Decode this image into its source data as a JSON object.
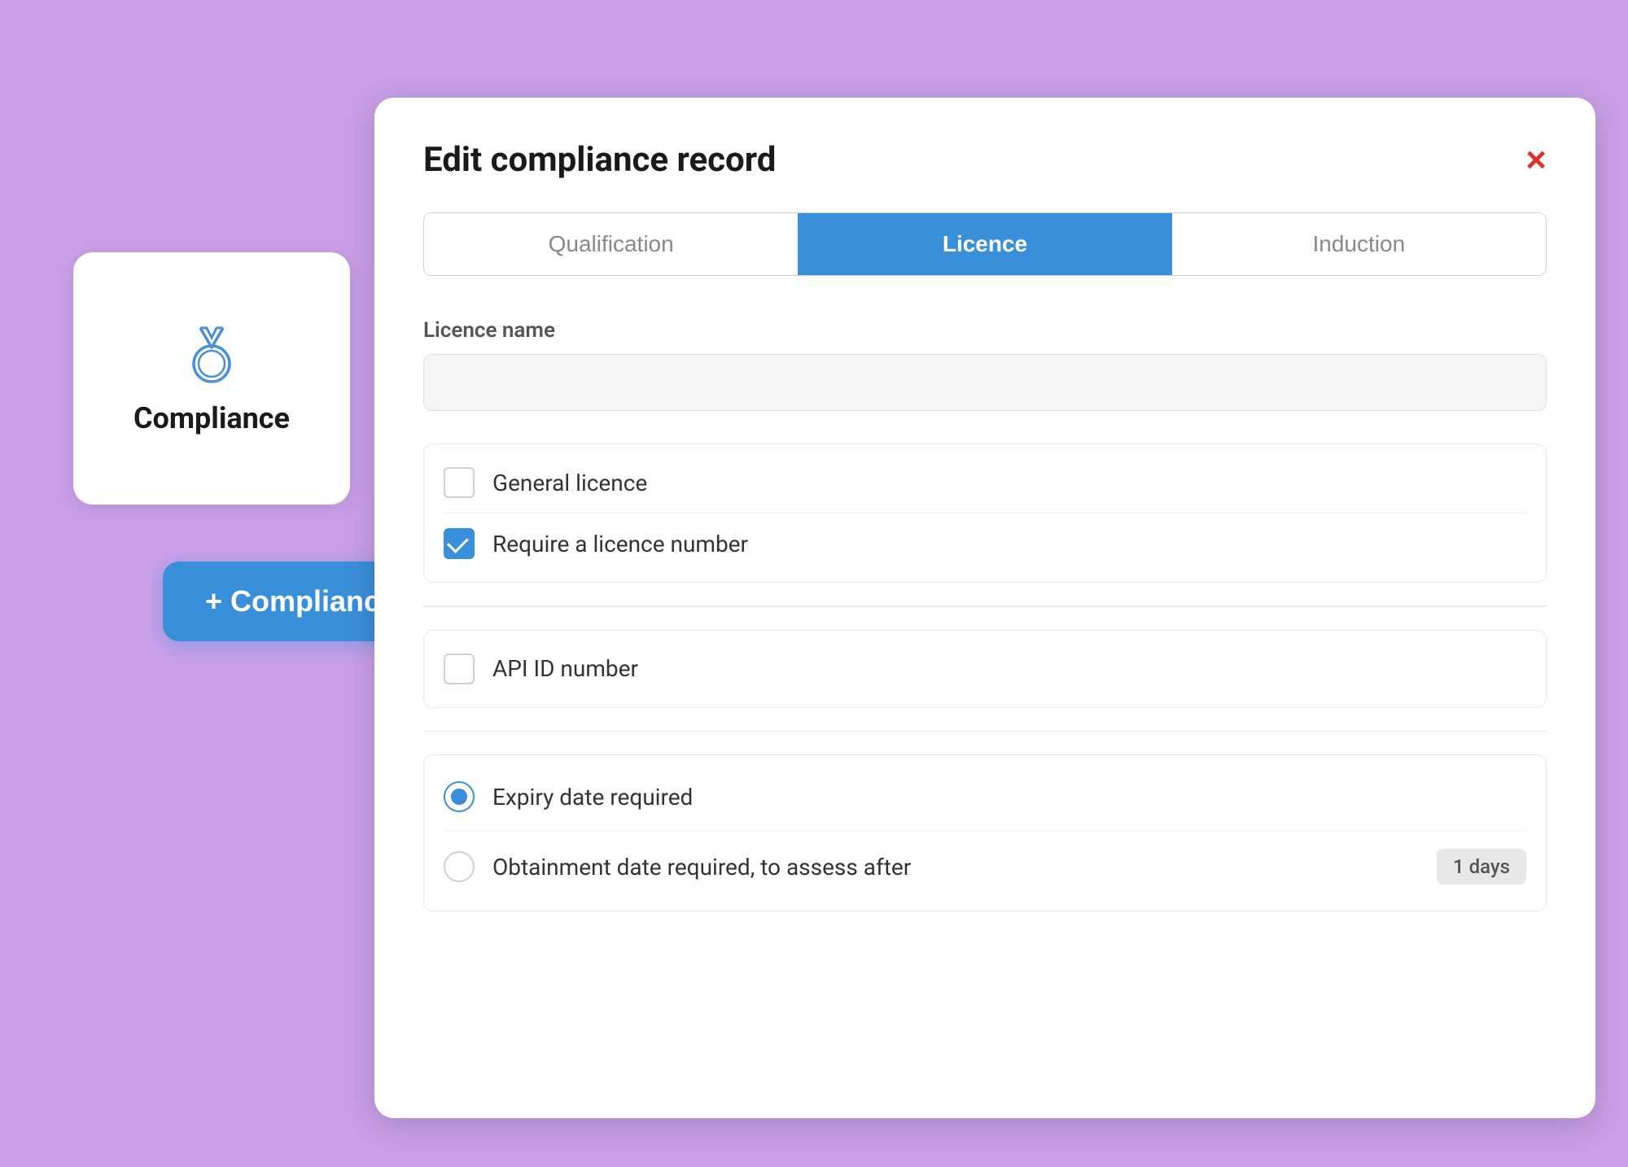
{
  "background": {
    "color": "#c9a0e8"
  },
  "compliance_card": {
    "label": "Compliance",
    "icon_alt": "compliance-medal-icon"
  },
  "add_record_button": {
    "label": "+ Compliance record"
  },
  "modal": {
    "title": "Edit compliance record",
    "close_label": "×",
    "tabs": [
      {
        "label": "Qualification",
        "active": false
      },
      {
        "label": "Licence",
        "active": true
      },
      {
        "label": "Induction",
        "active": false
      }
    ],
    "licence_name_label": "Licence name",
    "licence_name_placeholder": "",
    "checkboxes": [
      {
        "label": "General licence",
        "checked": false
      },
      {
        "label": "Require a licence number",
        "checked": true
      }
    ],
    "api_checkbox": {
      "label": "API ID number",
      "checked": false
    },
    "radios": [
      {
        "label": "Expiry date required",
        "checked": true
      },
      {
        "label": "Obtainment date required, to assess after",
        "checked": false,
        "badge": "1 days"
      }
    ]
  }
}
